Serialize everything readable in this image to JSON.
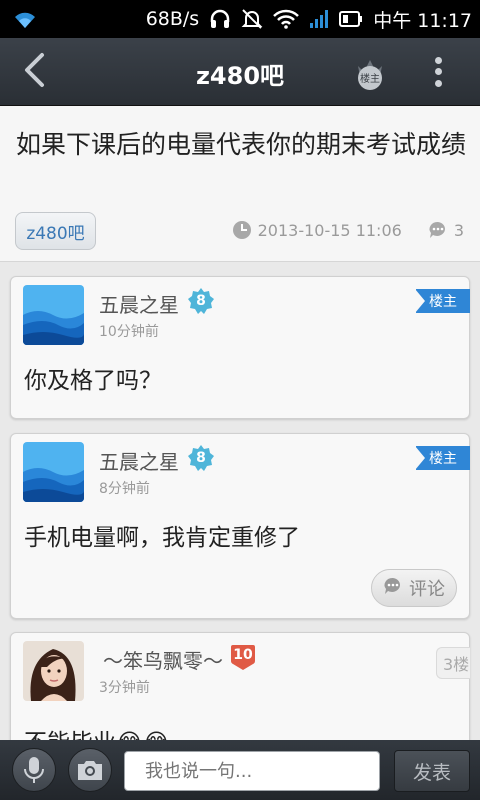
{
  "status_bar": {
    "network_speed": "68B/s",
    "time": "中午 11:17"
  },
  "title_bar": {
    "title": "z480吧",
    "owner_icon_label": "楼主"
  },
  "post": {
    "title": "如果下课后的电量代表你的期末考试成绩",
    "forum": "z480吧",
    "date": "2013-10-15 11:06",
    "reply_count": "3"
  },
  "replies": [
    {
      "username": "五晨之星",
      "level": "8",
      "time": "10分钟前",
      "badge": "楼主",
      "content": "你及格了吗？"
    },
    {
      "username": "五晨之星",
      "level": "8",
      "time": "8分钟前",
      "badge": "楼主",
      "content": "手机电量啊，我肯定重修了",
      "comment_label": "评论"
    },
    {
      "username": "～笨鸟飘零～",
      "level": "10",
      "time": "3分钟前",
      "floor": "3楼",
      "content": "不能毕业😂😂"
    }
  ],
  "bottom_bar": {
    "input_placeholder": "我也说一句...",
    "send_label": "发表"
  },
  "colors": {
    "accent_blue": "#2f86d6",
    "level_teal": "#4fb5d9",
    "level_red": "#e05a45",
    "titlebar": "#2f353b"
  },
  "icons": [
    "wifi-icon",
    "headset-icon",
    "mute-icon",
    "signal-icon",
    "battery-icon",
    "back-icon",
    "owner-crown-icon",
    "more-icon",
    "clock-icon",
    "comment-icon",
    "mic-icon",
    "camera-icon"
  ]
}
